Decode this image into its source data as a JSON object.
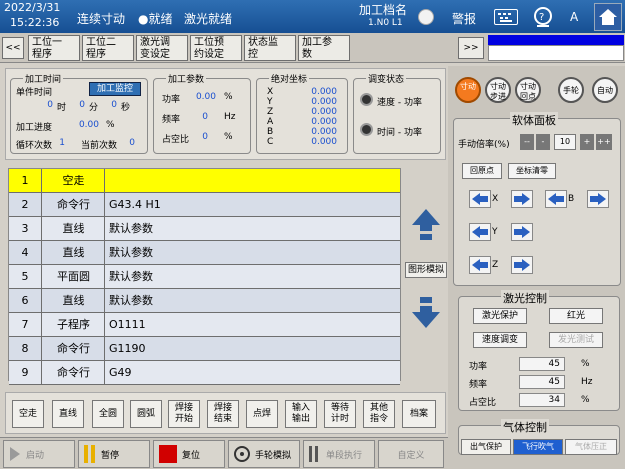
{
  "topbar": {
    "date": "2022/3/31",
    "time": "15:22:36",
    "mode": "连续寸动",
    "status_ready": "●就绪",
    "laser_status": "激光就绪",
    "file_label": "加工档名",
    "file_name": "1.N0 L1",
    "alarm": "警报",
    "lang": "A"
  },
  "tabs": {
    "prev": "<<",
    "next": ">>",
    "items": [
      "工位一\n程序",
      "工位二\n程序",
      "激光调\n变设定",
      "工位预\n约设定",
      "状态监\n控",
      "加工参\n数"
    ]
  },
  "time_group": {
    "title": "加工时间",
    "single_time_label": "单件时间",
    "monitor_button": "加工监控",
    "h_val": "0",
    "h_unit": "时",
    "m_val": "0",
    "m_unit": "分",
    "s_val": "0",
    "s_unit": "秒",
    "progress_label": "加工进度",
    "progress_val": "0.00",
    "progress_unit": "%",
    "loop_label": "循环次数",
    "loop_val": "1",
    "current_label": "当前次数",
    "current_val": "0"
  },
  "params_group": {
    "title": "加工参数",
    "power_label": "功率",
    "power_val": "0.00",
    "power_unit": "%",
    "freq_label": "频率",
    "freq_val": "0",
    "freq_unit": "Hz",
    "duty_label": "占空比",
    "duty_val": "0",
    "duty_unit": "%"
  },
  "coords_group": {
    "title": "绝对坐标",
    "axes": [
      "X",
      "Y",
      "Z",
      "A",
      "B",
      "C"
    ],
    "values": [
      "0.000",
      "0.000",
      "0.000",
      "0.000",
      "0.000",
      "0.000"
    ]
  },
  "adjust_group": {
    "title": "调变状态",
    "speed_power": "速度 - 功率",
    "time_power": "时间 - 功率"
  },
  "program": {
    "rows": [
      {
        "n": "1",
        "cmd": "空走",
        "arg": ""
      },
      {
        "n": "2",
        "cmd": "命令行",
        "arg": "G43.4 H1"
      },
      {
        "n": "3",
        "cmd": "直线",
        "arg": "默认参数"
      },
      {
        "n": "4",
        "cmd": "直线",
        "arg": "默认参数"
      },
      {
        "n": "5",
        "cmd": "平面圆",
        "arg": "默认参数"
      },
      {
        "n": "6",
        "cmd": "直线",
        "arg": "默认参数"
      },
      {
        "n": "7",
        "cmd": "子程序",
        "arg": "O1111"
      },
      {
        "n": "8",
        "cmd": "命令行",
        "arg": "G1190"
      },
      {
        "n": "9",
        "cmd": "命令行",
        "arg": "G49"
      }
    ],
    "graphic_sim": "图形模拟"
  },
  "cmd_buttons": [
    "空走",
    "直线",
    "全圆",
    "圆弧",
    "焊接\n开始",
    "焊接\n结束",
    "点焊",
    "输入\n输出",
    "等待\n计时",
    "其他\n指令",
    "档案"
  ],
  "func_buttons": [
    "启动",
    "暂停",
    "复位",
    "手轮模拟",
    "单段执行",
    "自定义"
  ],
  "mode_buttons": [
    "寸动",
    "寸动步进",
    "寸动回点",
    "手轮",
    "自动"
  ],
  "panel": {
    "title": "软体面板",
    "rate_label": "手动倍率(%)",
    "rate_val": "10",
    "btn_mm": "--",
    "btn_m": "-",
    "btn_p": "+",
    "btn_pp": "++",
    "home": "回原点",
    "clear": "坐标清零",
    "axis_x": "X",
    "axis_b": "B",
    "axis_y": "Y",
    "axis_z": "Z"
  },
  "laser": {
    "title": "激光控制",
    "protect": "激光保护",
    "red": "红光",
    "speed_adj": "速度调变",
    "test": "发光测试",
    "power_label": "功率",
    "power_val": "45",
    "power_unit": "%",
    "freq_label": "频率",
    "freq_val": "45",
    "freq_unit": "Hz",
    "duty_label": "占空比",
    "duty_val": "34",
    "duty_unit": "%"
  },
  "gas": {
    "title": "气体控制",
    "out": "出气保护",
    "blow": "飞行吹气",
    "pressure": "气体压正"
  },
  "colors": {
    "topbar": "#1c5aa3",
    "highlight": "#ffff00",
    "row_bg": "#d7dde8",
    "blue_text": "#1a4fcf"
  }
}
